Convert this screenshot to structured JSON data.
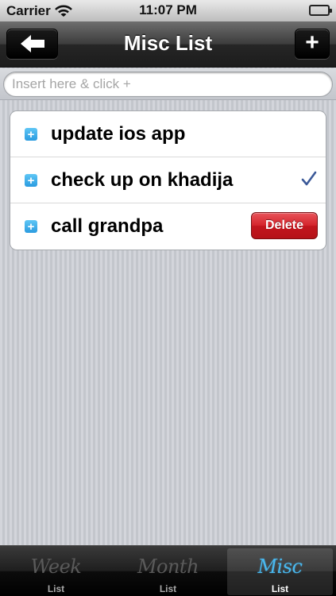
{
  "status_bar": {
    "carrier": "Carrier",
    "time": "11:07 PM"
  },
  "nav": {
    "title": "Misc List",
    "back_icon": "arrow-left-icon",
    "add_label": "+"
  },
  "insert": {
    "placeholder": "Insert here & click +"
  },
  "items": [
    {
      "label": "update ios app",
      "icon": "+"
    },
    {
      "label": "check up on khadija",
      "icon": "+"
    },
    {
      "label": "call grandpa",
      "icon": "+",
      "delete_label": "Delete"
    }
  ],
  "tabs": [
    {
      "script": "Week",
      "label": "List"
    },
    {
      "script": "Month",
      "label": "List"
    },
    {
      "script": "Misc",
      "label": "List",
      "active": true
    }
  ],
  "colors": {
    "accent": "#49b8ef",
    "delete": "#d4232b",
    "check": "#3b5998"
  }
}
